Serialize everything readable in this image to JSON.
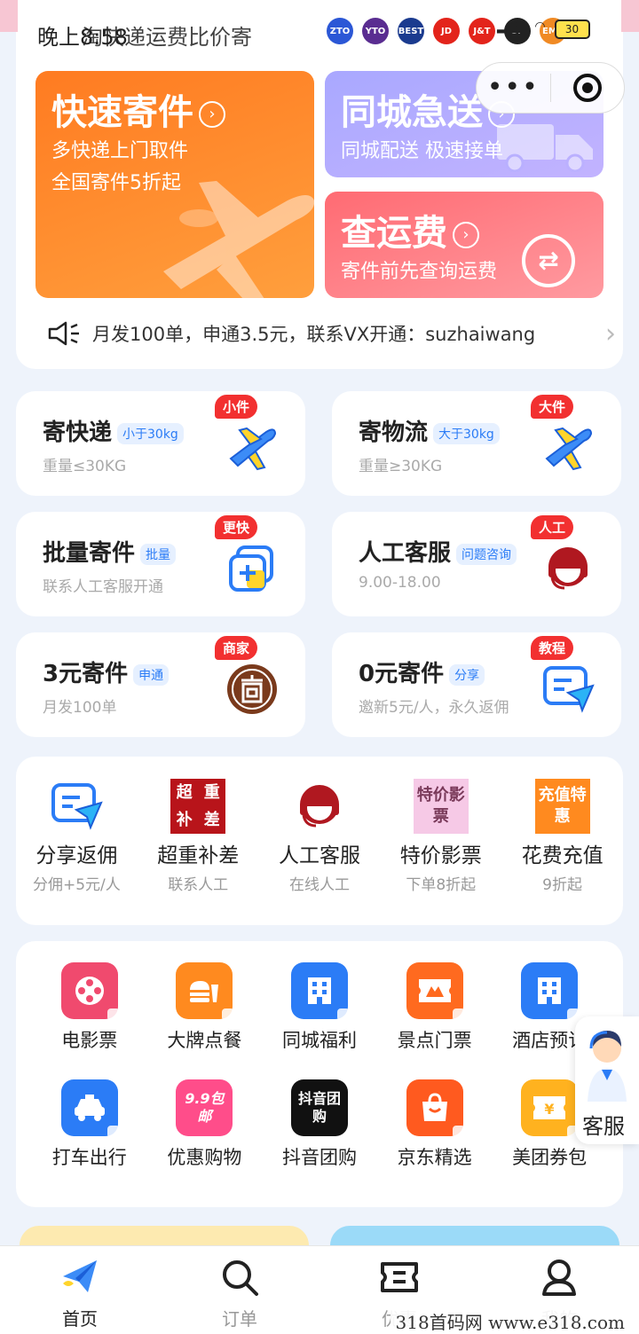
{
  "status": {
    "time": "晚上8:58",
    "app_title": "淘快递运费比价寄",
    "battery": "30"
  },
  "carriers": [
    {
      "name": "ZTO",
      "color": "#2b57d6"
    },
    {
      "name": "YTO",
      "color": "#5a2d91"
    },
    {
      "name": "BEST",
      "color": "#1b3b8f"
    },
    {
      "name": "JD",
      "color": "#e3241b"
    },
    {
      "name": "J&T",
      "color": "#e3241b"
    },
    {
      "name": "SF",
      "color": "#222222"
    },
    {
      "name": "EMS",
      "color": "#f08a24"
    }
  ],
  "banners": {
    "fast": {
      "title": "快速寄件",
      "line1": "多快递上门取件",
      "line2": "全国寄件5折起"
    },
    "city": {
      "title": "同城急送",
      "sub": "同城配送 极速接单"
    },
    "fee": {
      "title": "查运费",
      "sub": "寄件前先查询运费"
    }
  },
  "notice": {
    "text": "月发100单，申通3.5元，联系VX开通：suzhaiwang"
  },
  "services": [
    {
      "title": "寄快递",
      "tag": "小于30kg",
      "sub": "重量≤30KG",
      "badge": "小件"
    },
    {
      "title": "寄物流",
      "tag": "大于30kg",
      "sub": "重量≥30KG",
      "badge": "大件"
    },
    {
      "title": "批量寄件",
      "tag": "批量",
      "sub": "联系人工客服开通",
      "badge": "更快"
    },
    {
      "title": "人工客服",
      "tag": "问题咨询",
      "sub": "9.00-18.00",
      "badge": "人工"
    },
    {
      "title": "3元寄件",
      "tag": "申通",
      "sub": "月发100单",
      "badge": "商家"
    },
    {
      "title": "0元寄件",
      "tag": "分享",
      "sub": "邀新5元/人，永久返佣",
      "badge": "教程"
    }
  ],
  "quick": [
    {
      "label": "分享返佣",
      "sub": "分佣+5元/人"
    },
    {
      "label": "超重补差",
      "sub": "联系人工",
      "icon_text": [
        "超",
        "重",
        "补",
        "差"
      ]
    },
    {
      "label": "人工客服",
      "sub": "在线人工"
    },
    {
      "label": "特价影票",
      "sub": "下单8折起",
      "icon_text": "特价影票"
    },
    {
      "label": "花费充值",
      "sub": "9折起",
      "icon_text": "充值特惠"
    }
  ],
  "grid": [
    {
      "label": "电影票",
      "color": "#f04a6e"
    },
    {
      "label": "大牌点餐",
      "color": "#ff8a1f"
    },
    {
      "label": "同城福利",
      "color": "#2b7cf6"
    },
    {
      "label": "景点门票",
      "color": "#ff6a1f"
    },
    {
      "label": "酒店预订",
      "color": "#2b7cf6"
    },
    {
      "label": "打车出行",
      "color": "#2b7cf6"
    },
    {
      "label": "优惠购物",
      "color": "#ff4d8a",
      "icon_text": "9.9包邮"
    },
    {
      "label": "抖音团购",
      "color": "#111111",
      "icon_text": "抖音团购"
    },
    {
      "label": "京东精选",
      "color": "#ff5a1f"
    },
    {
      "label": "美团券包",
      "color": "#ffb21f"
    }
  ],
  "float_service": {
    "label": "客服"
  },
  "tabs": [
    {
      "label": "首页"
    },
    {
      "label": "订单"
    },
    {
      "label": "优惠"
    },
    {
      "label": "我的"
    }
  ],
  "watermark": "318首码网 www.e318.com"
}
